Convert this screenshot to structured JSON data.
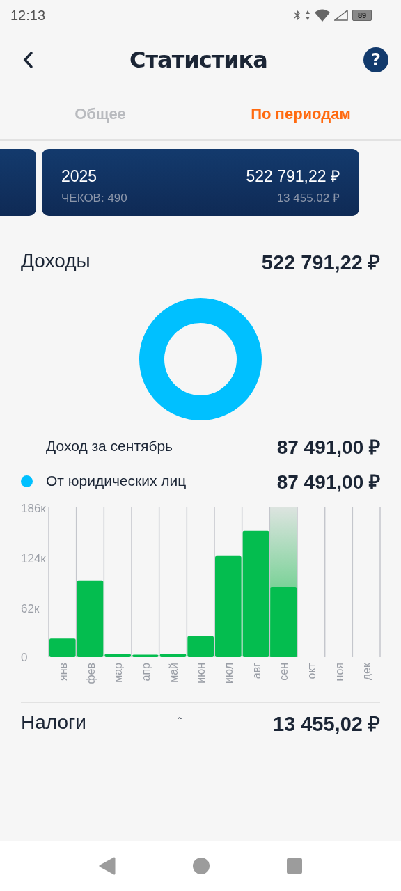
{
  "status_bar": {
    "time": "12:13",
    "battery": "89"
  },
  "header": {
    "title": "Статистика",
    "help": "?"
  },
  "tabs": [
    {
      "label": "Общее",
      "selected": false
    },
    {
      "label": "По периодам",
      "selected": true
    }
  ],
  "period_cards": [
    {
      "kind": "partial"
    },
    {
      "kind": "full",
      "year": "2025",
      "receipts": "ЧЕКОВ: 490",
      "income": "522 791,22 ₽",
      "tax": "13 455,02 ₽"
    }
  ],
  "income": {
    "title": "Доходы",
    "total": "522 791,22 ₽",
    "month_row": {
      "label": "Доход за сентябрь",
      "amount": "87 491,00 ₽"
    },
    "legend": [
      {
        "label": "От юридических лиц",
        "amount": "87 491,00 ₽",
        "color": "#00c0ff"
      }
    ],
    "chart_data": {
      "type": "bar",
      "categories": [
        "янв",
        "фев",
        "мар",
        "апр",
        "май",
        "июн",
        "июл",
        "авг",
        "сен",
        "окт",
        "ноя",
        "дек"
      ],
      "values": [
        23,
        95,
        4,
        3,
        4,
        26,
        125,
        156,
        87,
        null,
        null,
        null
      ],
      "ylim": [
        0,
        186
      ],
      "yticks": [
        {
          "value": 0,
          "label": "0"
        },
        {
          "value": 62,
          "label": "62к"
        },
        {
          "value": 124,
          "label": "124к"
        },
        {
          "value": 186,
          "label": "186к"
        }
      ]
    },
    "month_columns": [
      {
        "selected": false
      },
      {
        "selected": false
      },
      {
        "selected": false
      },
      {
        "selected": false
      },
      {
        "selected": false
      },
      {
        "selected": false
      },
      {
        "selected": false
      },
      {
        "selected": false
      },
      {
        "selected": true
      },
      {
        "selected": false
      },
      {
        "selected": false
      },
      {
        "selected": false
      }
    ]
  },
  "taxes": {
    "title": "Налоги",
    "caret": "ˆ",
    "amount": "13 455,02 ₽"
  }
}
